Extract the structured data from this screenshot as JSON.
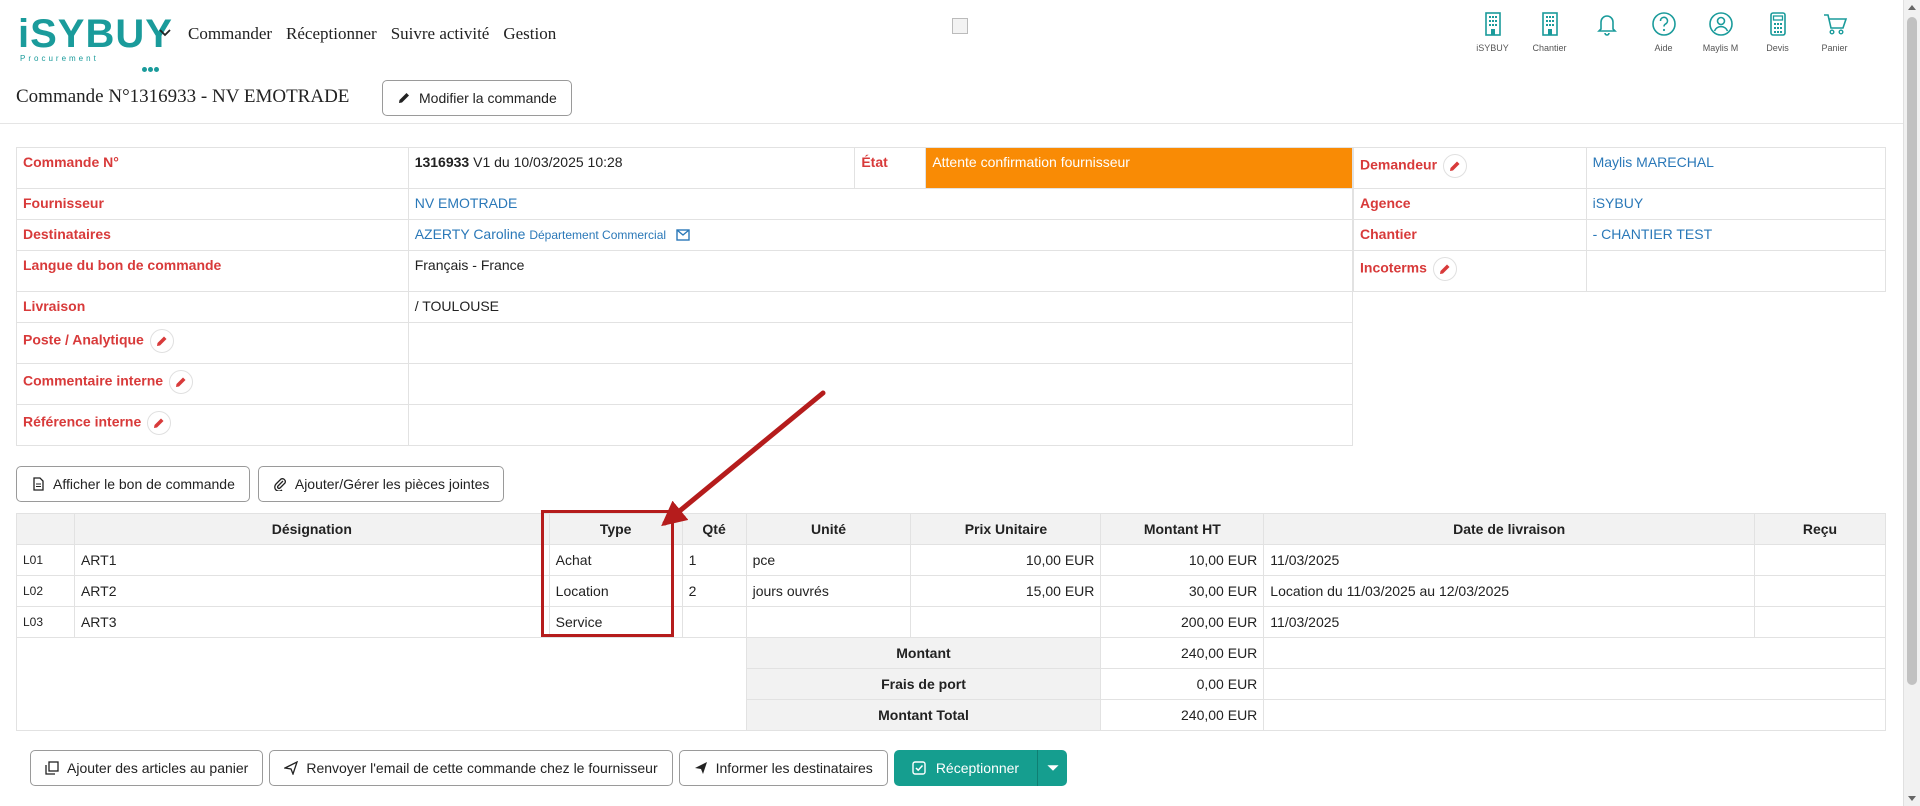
{
  "brand": {
    "logo_text": "iSYBUY",
    "logo_sub": "Procurement"
  },
  "nav": {
    "items": [
      "Commander",
      "Réceptionner",
      "Suivre activité",
      "Gestion"
    ]
  },
  "top_icons": [
    {
      "icon": "building-icon",
      "label": "iSYBUY"
    },
    {
      "icon": "building-icon",
      "label": "Chantier"
    },
    {
      "icon": "bell-icon",
      "label": ""
    },
    {
      "icon": "help-icon",
      "label": "Aide"
    },
    {
      "icon": "user-icon",
      "label": "Maylis M"
    },
    {
      "icon": "calculator-icon",
      "label": "Devis"
    },
    {
      "icon": "cart-icon",
      "label": "Panier"
    }
  ],
  "header": {
    "title": "Commande N°1316933 - NV EMOTRADE",
    "modify_label": "Modifier la commande"
  },
  "info": {
    "commande_label": "Commande N°",
    "commande_num": "1316933",
    "commande_rest": " V1 du 10/03/2025 10:28",
    "etat_label": "État",
    "etat_value": "Attente confirmation fournisseur",
    "fournisseur_label": "Fournisseur",
    "fournisseur_value": "NV EMOTRADE",
    "destinataires_label": "Destinataires",
    "destinataires_name": "AZERTY Caroline",
    "destinataires_dept": "Département Commercial",
    "langue_label": "Langue du bon de commande",
    "langue_value": "Français - France",
    "livraison_label": "Livraison",
    "livraison_value": "/ TOULOUSE",
    "poste_label": "Poste / Analytique",
    "commentaire_label": "Commentaire interne",
    "reference_label": "Référence interne",
    "demandeur_label": "Demandeur",
    "demandeur_value": "Maylis MARECHAL",
    "agence_label": "Agence",
    "agence_value": "iSYBUY",
    "chantier_label": "Chantier",
    "chantier_value": "- CHANTIER TEST",
    "incoterms_label": "Incoterms"
  },
  "actions": {
    "show_po": "Afficher le bon de commande",
    "attachments": "Ajouter/Gérer les pièces jointes"
  },
  "lines_table": {
    "headers": [
      "Désignation",
      "Type",
      "Qté",
      "Unité",
      "Prix Unitaire",
      "Montant HT",
      "Date de livraison",
      "Reçu"
    ],
    "rows": [
      {
        "ref": "L01",
        "designation": "ART1",
        "type": "Achat",
        "qte": "1",
        "unite": "pce",
        "prix": "10,00 EUR",
        "montant": "10,00 EUR",
        "date": "11/03/2025",
        "recu": ""
      },
      {
        "ref": "L02",
        "designation": "ART2",
        "type": "Location",
        "qte": "2",
        "unite": "jours ouvrés",
        "prix": "15,00 EUR",
        "montant": "30,00 EUR",
        "date": "Location du 11/03/2025 au 12/03/2025",
        "recu": ""
      },
      {
        "ref": "L03",
        "designation": "ART3",
        "type": "Service",
        "qte": "",
        "unite": "",
        "prix": "",
        "montant": "200,00 EUR",
        "date": "11/03/2025",
        "recu": ""
      }
    ],
    "totals": [
      {
        "label": "Montant",
        "value": "240,00 EUR"
      },
      {
        "label": "Frais de port",
        "value": "0,00 EUR"
      },
      {
        "label": "Montant Total",
        "value": "240,00 EUR"
      }
    ]
  },
  "bottom": {
    "add_cart": "Ajouter des articles au panier",
    "resend": "Renvoyer l'email de cette commande chez le fournisseur",
    "inform": "Informer les destinataires",
    "receive": "Réceptionner"
  },
  "colors": {
    "brand": "#1a9b9b",
    "label_red": "#d83a3a",
    "etat_orange": "#f98b05",
    "primary": "#159e8f",
    "annotation": "#b51c1c",
    "link": "#2a78b8"
  }
}
